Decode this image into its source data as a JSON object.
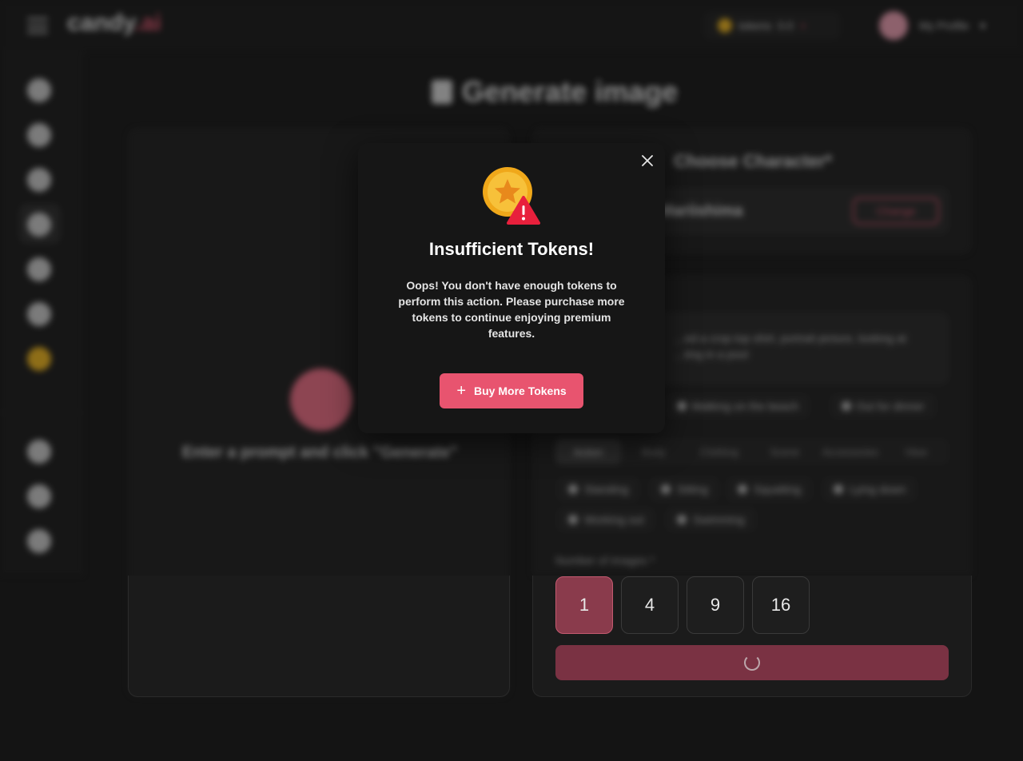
{
  "header": {
    "logo_main": "candy",
    "logo_accent": ".ai",
    "tokens_label": "tokens",
    "tokens_value": "0.0",
    "profile_label": "My Profile"
  },
  "page": {
    "title": "Generate image",
    "empty_state": "Enter a prompt and click \"Generate\""
  },
  "character": {
    "title": "Choose Character*",
    "name": "Mariishima",
    "change_label": "Change"
  },
  "prompt": {
    "text": "...ed a crop top shirt, portrait picture, looking at ...ting in a pool"
  },
  "scenes": [
    "Walking on the beach",
    "Out for dinner"
  ],
  "tabs": [
    {
      "label": "Action",
      "active": true
    },
    {
      "label": "Body",
      "active": false
    },
    {
      "label": "Clothing",
      "active": false
    },
    {
      "label": "Scene",
      "active": false
    },
    {
      "label": "Accessories",
      "active": false
    },
    {
      "label": "View",
      "active": false
    }
  ],
  "poses": [
    "Standing",
    "Sitting",
    "Squatting",
    "Lying down",
    "Working out",
    "Swimming"
  ],
  "number_of_images": {
    "label": "Number of images *",
    "options": [
      "1",
      "4",
      "9",
      "16"
    ],
    "selected": "1"
  },
  "modal": {
    "title": "Insufficient Tokens!",
    "body": "Oops! You don't have enough tokens to perform this action. Please purchase more tokens to continue enjoying premium features.",
    "button_label": "Buy More Tokens",
    "icon": "coin-warning-icon"
  },
  "colors": {
    "accent": "#e8546f",
    "coin": "#f3b81c",
    "warning": "#e8203c"
  }
}
